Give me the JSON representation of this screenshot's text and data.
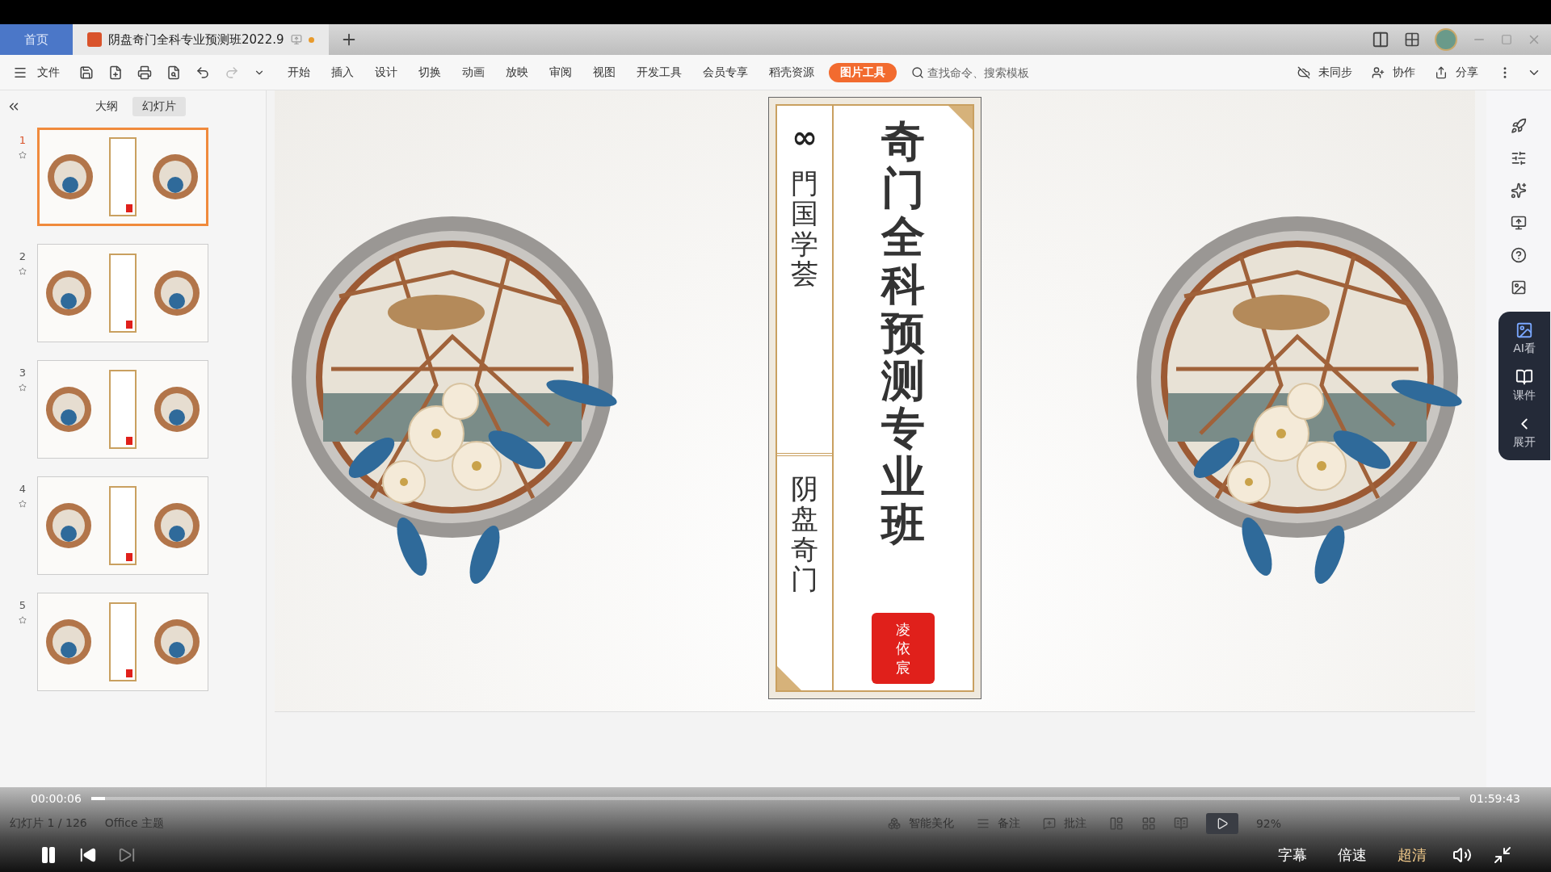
{
  "tabs": [
    {
      "label": "首页",
      "kind": "home",
      "selected": false
    },
    {
      "label": "阴盘奇门全科专业预测班2022.9",
      "kind": "document",
      "selected": true,
      "modified": true
    }
  ],
  "toolbar": {
    "file": "文件",
    "menus": [
      "开始",
      "插入",
      "设计",
      "切换",
      "动画",
      "放映",
      "审阅",
      "视图",
      "开发工具",
      "会员专享",
      "稻壳资源"
    ],
    "context_tab": "图片工具",
    "search": {
      "placeholder": "查找命令、搜索模板"
    },
    "actions": [
      "未同步",
      "协作",
      "分享"
    ]
  },
  "panel": {
    "tabs": [
      {
        "label": "大纲",
        "selected": false
      },
      {
        "label": "幻灯片",
        "selected": true
      }
    ],
    "slides": [
      {
        "number": "1",
        "selected": true
      },
      {
        "number": "2",
        "selected": false
      },
      {
        "number": "3",
        "selected": false
      },
      {
        "number": "4",
        "selected": false
      },
      {
        "number": "5",
        "selected": false
      }
    ]
  },
  "slide": {
    "mark": "∞",
    "side_upper": "門国学荟",
    "side_lower": "阴盘奇门",
    "title": "奇门全科预测专业班",
    "seal": "凌依宸"
  },
  "side_dock": [
    "AI看",
    "课件",
    "展开"
  ],
  "status_bar": {
    "slide_counter": "幻灯片 1 / 126",
    "theme": "Office 主题",
    "beautify": "智能美化",
    "notes": "备注",
    "comments": "批注",
    "zoom": "92%"
  },
  "player": {
    "elapsed": "00:00:06",
    "total": "01:59:43",
    "level": 0.01,
    "playing": true,
    "options": [
      "字幕",
      "倍速",
      "超清"
    ]
  }
}
